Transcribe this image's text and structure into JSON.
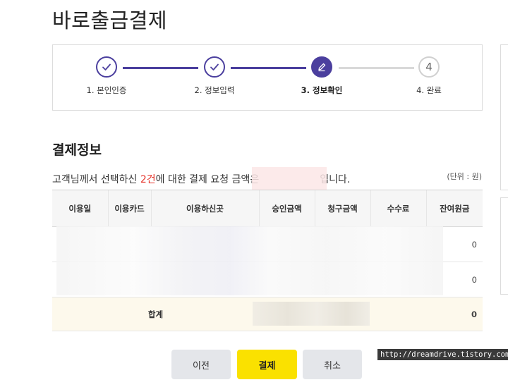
{
  "page_title": "바로출금결제",
  "steps": [
    {
      "label": "1. 본인인증",
      "state": "done"
    },
    {
      "label": "2. 정보입력",
      "state": "done"
    },
    {
      "label": "3. 정보확인",
      "state": "active"
    },
    {
      "label": "4. 완료",
      "state": "todo",
      "number": "4"
    }
  ],
  "colors": {
    "accent": "#4b3f9e",
    "highlight": "#e5352c",
    "pay_button": "#fae100"
  },
  "section_title": "결제정보",
  "description": {
    "prefix": "고객님께서 선택하신 ",
    "count": "2건",
    "middle": "에 대한 결제 요청 금액은",
    "suffix": "입니다."
  },
  "unit": "(단위 : 원)",
  "table": {
    "headers": [
      "이용일",
      "이용카드",
      "이용하신곳",
      "승인금액",
      "청구금액",
      "수수료",
      "잔여원금"
    ],
    "rows": [
      {
        "balance": "0"
      },
      {
        "balance": "0"
      }
    ],
    "total": {
      "label": "합계",
      "balance": "0"
    }
  },
  "buttons": {
    "prev": "이전",
    "pay": "결제",
    "cancel": "취소"
  },
  "watermark": "http://dreamdrive.tistory.com"
}
